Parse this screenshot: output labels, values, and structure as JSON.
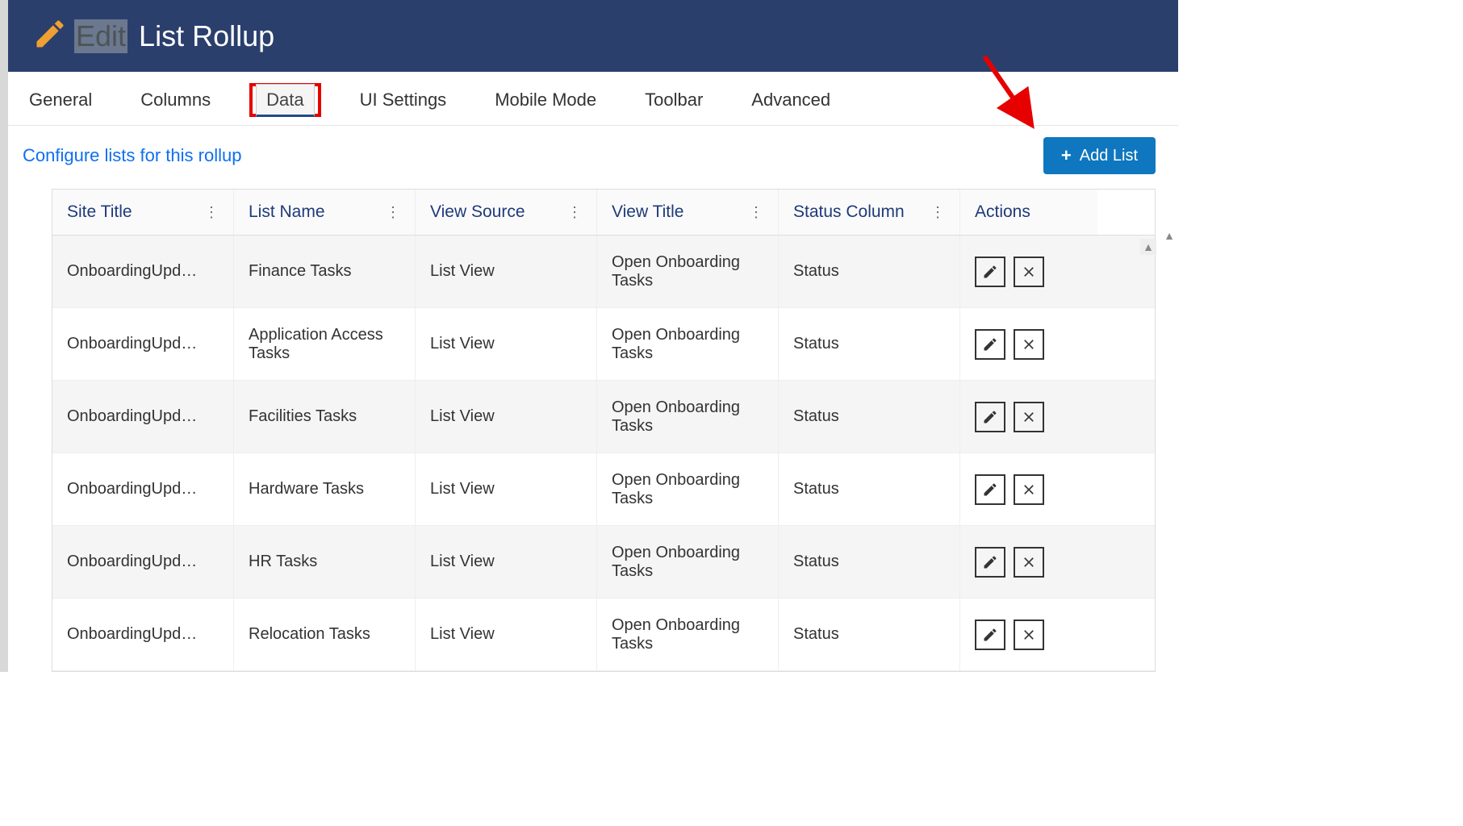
{
  "header": {
    "prefix": "Edit",
    "title": "List Rollup"
  },
  "tabs": [
    {
      "label": "General",
      "active": false
    },
    {
      "label": "Columns",
      "active": false
    },
    {
      "label": "Data",
      "active": true,
      "highlighted": true
    },
    {
      "label": "UI Settings",
      "active": false
    },
    {
      "label": "Mobile Mode",
      "active": false
    },
    {
      "label": "Toolbar",
      "active": false
    },
    {
      "label": "Advanced",
      "active": false
    }
  ],
  "section_title": "Configure lists for this rollup",
  "add_button_label": "Add List",
  "grid": {
    "columns": [
      {
        "label": "Site Title"
      },
      {
        "label": "List Name"
      },
      {
        "label": "View Source"
      },
      {
        "label": "View Title"
      },
      {
        "label": "Status Column"
      },
      {
        "label": "Actions"
      }
    ],
    "rows": [
      {
        "site": "OnboardingUpd…",
        "list": "Finance Tasks",
        "source": "List View",
        "view": "Open Onboarding Tasks",
        "status": "Status"
      },
      {
        "site": "OnboardingUpd…",
        "list": "Application Access Tasks",
        "source": "List View",
        "view": "Open Onboarding Tasks",
        "status": "Status"
      },
      {
        "site": "OnboardingUpd…",
        "list": "Facilities Tasks",
        "source": "List View",
        "view": "Open Onboarding Tasks",
        "status": "Status"
      },
      {
        "site": "OnboardingUpd…",
        "list": "Hardware Tasks",
        "source": "List View",
        "view": "Open Onboarding Tasks",
        "status": "Status"
      },
      {
        "site": "OnboardingUpd…",
        "list": "HR Tasks",
        "source": "List View",
        "view": "Open Onboarding Tasks",
        "status": "Status"
      },
      {
        "site": "OnboardingUpd…",
        "list": "Relocation Tasks",
        "source": "List View",
        "view": "Open Onboarding Tasks",
        "status": "Status"
      }
    ]
  }
}
